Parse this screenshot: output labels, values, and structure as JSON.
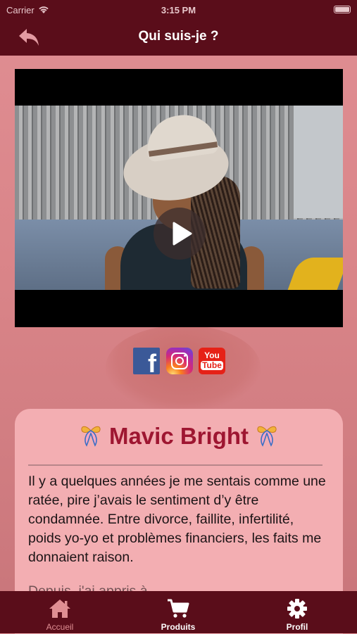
{
  "status_bar": {
    "carrier": "Carrier",
    "time": "3:15 PM"
  },
  "nav": {
    "title": "Qui suis-je ?",
    "back_icon": "back-arrow-icon"
  },
  "video": {
    "play_icon": "play-icon"
  },
  "social": [
    {
      "name": "facebook",
      "icon": "facebook-icon",
      "label": "f"
    },
    {
      "name": "instagram",
      "icon": "instagram-icon"
    },
    {
      "name": "youtube",
      "icon": "youtube-icon",
      "label_top": "You",
      "label_bottom": "Tube"
    }
  ],
  "profile": {
    "name": "Mavic Bright",
    "bio": "Il y a quelques années je me sentais comme une ratée, pire j’avais le sentiment d’y être condamnée. Entre divorce, faillite, infertilité, poids yo-yo et problèmes financiers, les faits me donnaient raison.",
    "bio_more": "Depuis, j'ai appris à..."
  },
  "tabs": [
    {
      "label": "Accueil",
      "icon": "home-icon",
      "active": true
    },
    {
      "label": "Produits",
      "icon": "cart-icon",
      "active": false
    },
    {
      "label": "Profil",
      "icon": "gear-icon",
      "active": false
    }
  ],
  "colors": {
    "bar": "#5a0d1a",
    "accent": "#9e1631",
    "active_tab": "#e08e93",
    "card": "#f3aeb2"
  }
}
